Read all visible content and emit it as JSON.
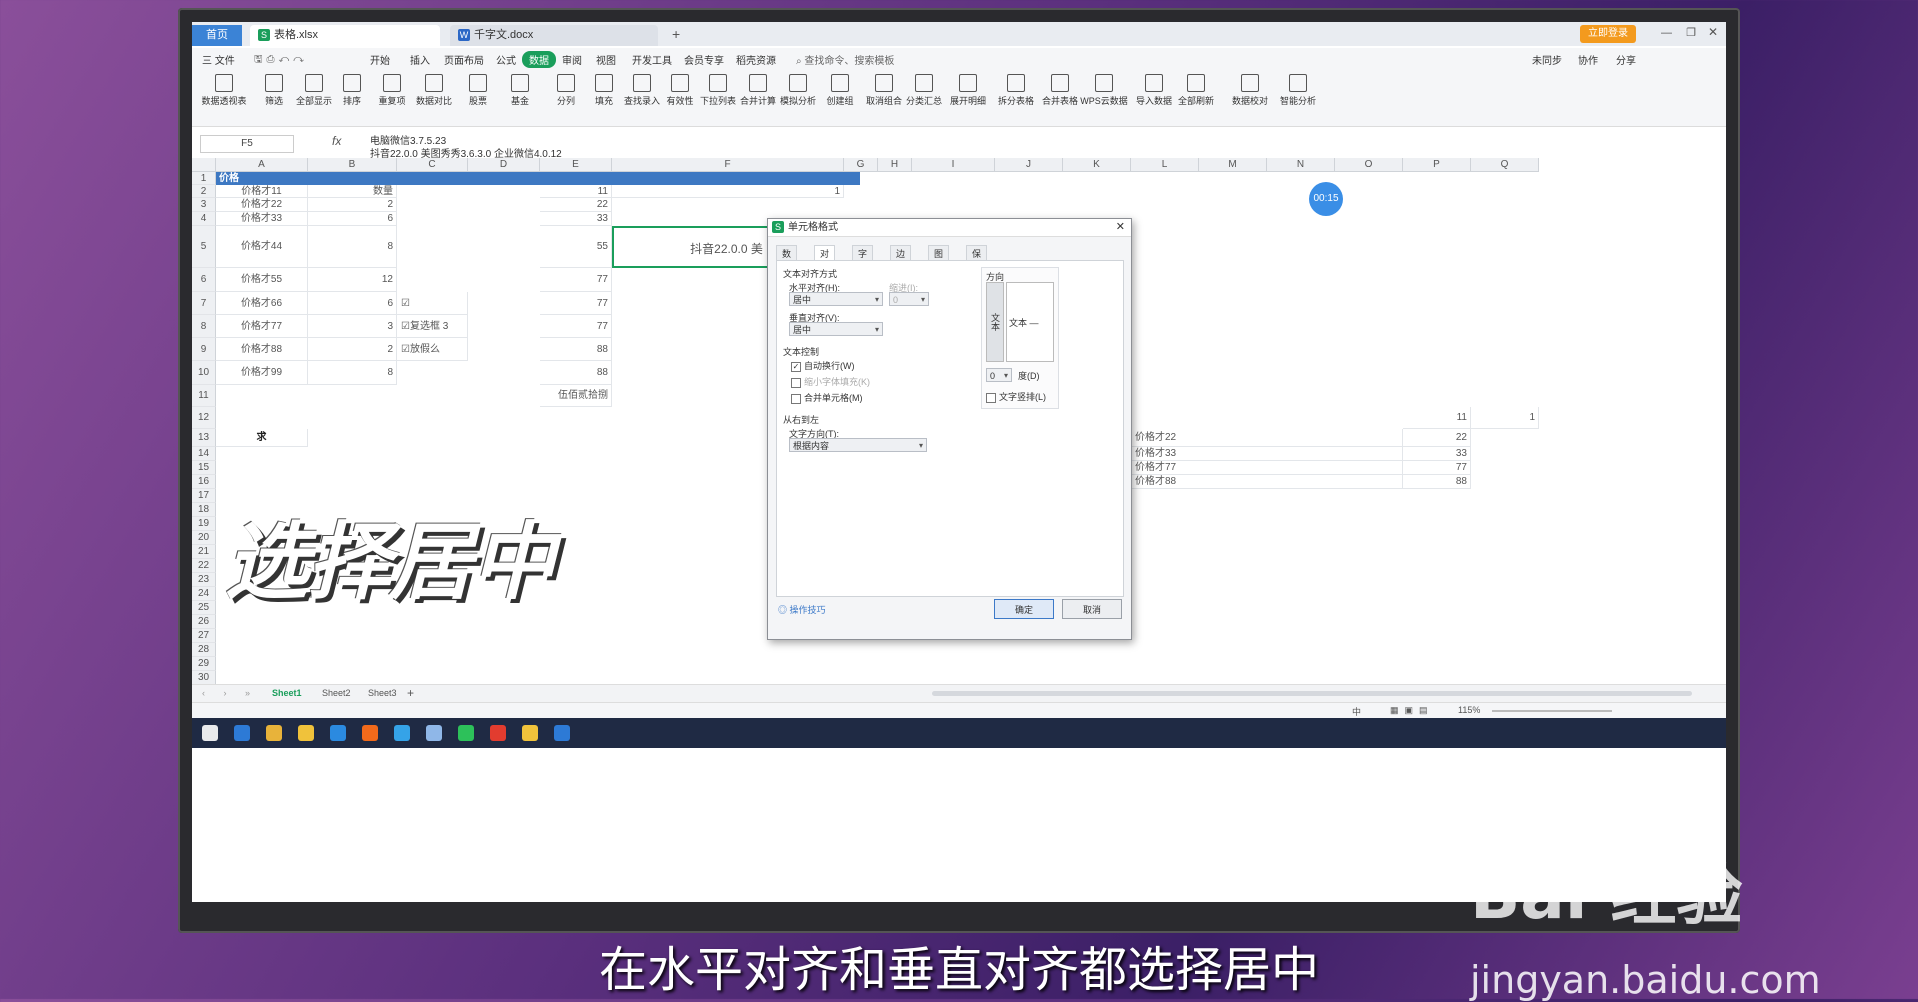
{
  "tabs": {
    "home": "首页",
    "active": "表格.xlsx",
    "inactive": "千字文.docx",
    "add": "+",
    "login": "立即登录",
    "s_badge": "S",
    "w_badge": "W"
  },
  "menu": {
    "file": "三 文件",
    "items": [
      "开始",
      "插入",
      "页面布局",
      "公式",
      "数据",
      "审阅",
      "视图",
      "开发工具",
      "会员专享",
      "稻壳资源"
    ],
    "selected_index": 4,
    "search": "查找命令、搜索模板",
    "sync": "未同步",
    "collab": "协作",
    "share": "分享"
  },
  "ribbon": [
    "数据透视表",
    "筛选",
    "全部显示",
    "排序",
    "重复项",
    "数据对比",
    "股票",
    "基金",
    "分列",
    "填充",
    "查找录入",
    "有效性",
    "下拉列表",
    "合并计算",
    "模拟分析",
    "创建组",
    "取消组合",
    "分类汇总",
    "展开明细",
    "拆分表格",
    "合并表格",
    "WPS云数据",
    "导入数据",
    "全部刷新",
    "数据校对",
    "智能分析"
  ],
  "formula": {
    "namebox": "F5",
    "fx": "fx",
    "line1": "电脑微信3.7.5.23",
    "line2": "抖音22.0.0 美图秀秀3.6.3.0 企业微信4.0.12"
  },
  "columns": [
    "A",
    "B",
    "C",
    "D",
    "E",
    "F",
    "G",
    "H",
    "I",
    "J",
    "K",
    "L",
    "M",
    "N",
    "O",
    "P",
    "Q"
  ],
  "rows": [
    "1",
    "2",
    "3",
    "4",
    "5",
    "6",
    "7",
    "8",
    "9",
    "10",
    "11",
    "12",
    "13",
    "14",
    "15",
    "16",
    "17",
    "18",
    "19",
    "20",
    "21",
    "22",
    "23",
    "24",
    "25",
    "26",
    "27",
    "28",
    "29",
    "30"
  ],
  "cells": {
    "banner": "价格",
    "a2": "价格才11",
    "b2": "数量",
    "e2": "11",
    "f2": "1",
    "a3": "价格才22",
    "b3": "2",
    "e3": "22",
    "a4": "价格才33",
    "b4": "6",
    "e4": "33",
    "a5": "价格才44",
    "b5": "8",
    "e5": "55",
    "f5": "抖音22.0.0 美",
    "a6": "价格才55",
    "b6": "12",
    "e6": "77",
    "a7": "价格才66",
    "b7": "6",
    "c7": "☑",
    "e7": "77",
    "a8": "价格才77",
    "b8": "3",
    "c8": "☑复选框 3",
    "e8": "77",
    "a9": "价格才88",
    "b9": "2",
    "c9": "☑放假么",
    "e9": "88",
    "a10": "价格才99",
    "b10": "8",
    "e10": "88",
    "e11": "伍佰贰拾捌",
    "a13": "求",
    "p12": "11",
    "q12": "1",
    "l13": "价格才22",
    "p13": "22",
    "l14": "价格才33",
    "p14": "33",
    "l15": "价格才77",
    "p15": "77",
    "l16": "价格才88",
    "p16": "88"
  },
  "sheets": [
    "Sheet1",
    "Sheet2",
    "Sheet3"
  ],
  "status": {
    "zoom": "115%",
    "input_mode": "中"
  },
  "timer": "00:15",
  "dialog": {
    "title": "单元格格式",
    "tabs": [
      "数字",
      "对齐",
      "字体",
      "边框",
      "图案",
      "保护"
    ],
    "active_tab": "对齐",
    "text_align_section": "文本对齐方式",
    "h_align_label": "水平对齐(H):",
    "h_align_value": "居中",
    "indent_label": "缩进(I):",
    "indent_value": "0",
    "v_align_label": "垂直对齐(V):",
    "v_align_value": "居中",
    "text_control_section": "文本控制",
    "wrap_label": "自动换行(W)",
    "shrink_label": "缩小字体填充(K)",
    "merge_label": "合并单元格(M)",
    "rtl_section": "从右到左",
    "direction_label": "文字方向(T):",
    "direction_value": "根据内容",
    "orientation_section": "方向",
    "vertical_text": "文本",
    "orient_text": "文本 —",
    "degree_value": "0",
    "degree_label": "度(D)",
    "vertical_arrange": "文字竖排(L)",
    "tips": "操作技巧",
    "ok": "确定",
    "cancel": "取消"
  },
  "overlay": "选择居中",
  "subtitle": "在水平对齐和垂直对齐都选择居中",
  "watermark": {
    "logo": "Bai 经验",
    "url": "jingyan.baidu.com"
  },
  "colors": {
    "accent": "#1a9e5b",
    "banner": "#3d78c2",
    "login": "#f39a1e"
  }
}
